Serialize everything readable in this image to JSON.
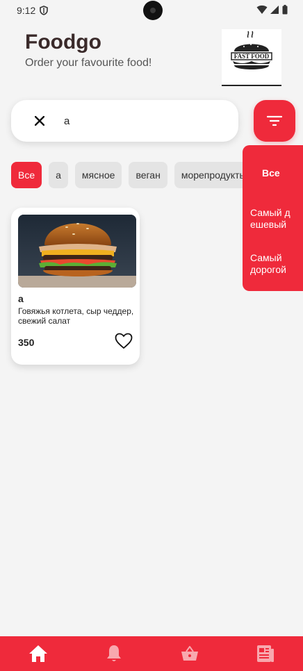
{
  "status_bar": {
    "time": "9:12"
  },
  "header": {
    "title": "Foodgo",
    "subtitle": "Order your favourite food!",
    "logo_text": "FAST FOOD"
  },
  "search": {
    "value": "а"
  },
  "categories": [
    {
      "label": "Все",
      "active": true
    },
    {
      "label": "а",
      "active": false
    },
    {
      "label": "мясное",
      "active": false
    },
    {
      "label": "веган",
      "active": false
    },
    {
      "label": "морепродукты",
      "active": false
    }
  ],
  "sort_menu": {
    "items": [
      "Все",
      "Самый д ешевый",
      "Самый дорогой"
    ]
  },
  "products": [
    {
      "name": "а",
      "description": "Говяжья котлета, сыр чеддер, свежий салат",
      "price": "350",
      "favorite": false
    }
  ],
  "bottom_nav": {
    "items": [
      "home-icon",
      "bell-icon",
      "basket-icon",
      "news-icon"
    ]
  },
  "colors": {
    "accent": "#ef2a3b",
    "background": "#f4f4f4",
    "chip": "#e4e4e4"
  }
}
